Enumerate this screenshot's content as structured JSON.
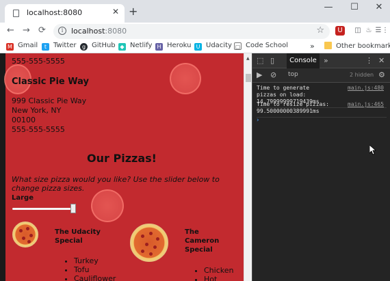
{
  "tab": {
    "title": "localhost:8080",
    "close": "✕",
    "new_tab": "+"
  },
  "window_controls": {
    "minimize": "—",
    "maximize": "☐",
    "close": "✕"
  },
  "toolbar": {
    "back": "←",
    "forward": "→",
    "reload": "⟳",
    "url_host": "localhost",
    "url_port": ":8080",
    "star": "☆",
    "ext1": "U",
    "ext2": "◫",
    "ext3": "♨",
    "ext4": "☰",
    "ext5": "⋮"
  },
  "bookmarks": [
    {
      "label": "Gmail",
      "icon": "M",
      "color": "#d93025"
    },
    {
      "label": "Twitter",
      "icon": "t",
      "color": "#1da1f2"
    },
    {
      "label": "GitHub",
      "icon": "g",
      "color": "#24292e"
    },
    {
      "label": "Netlify",
      "icon": "◆",
      "color": "#20c6b7"
    },
    {
      "label": "Heroku",
      "icon": "H",
      "color": "#6762a6"
    },
    {
      "label": "Udacity",
      "icon": "U",
      "color": "#02b3e4"
    },
    {
      "label": "Code School",
      "icon": "▢",
      "color": "#555"
    }
  ],
  "bookmarks_more": "»",
  "bookmarks_other": "Other bookmarks",
  "page": {
    "top_phone": "555-555-5555",
    "shop_name": "Classic Pie Way",
    "address": [
      "999 Classic Pie Way",
      "New York, NY",
      "00100",
      "555-555-5555"
    ],
    "heading": "Our Pizzas!",
    "instruction": "What size pizza would you like? Use the slider below to change pizza sizes.",
    "size_label": "Large",
    "pizza1_name": "The Udacity Special",
    "pizza1_ingredients": [
      "Turkey",
      "Tofu",
      "Cauliflower"
    ],
    "pizza2_name": "The Cameron Special",
    "pizza2_ingredients": [
      "Chicken",
      "Hot"
    ]
  },
  "devtools": {
    "tab": "Console",
    "more": "»",
    "context": "top",
    "hidden": "2 hidden",
    "messages": [
      {
        "text": "Time to generate pizzas on load: 14.79999999719439ms",
        "source": "main.js:480"
      },
      {
        "text": "Time to resize pizzas: 99.50000000389991ms",
        "source": "main.js:465"
      }
    ],
    "prompt": "›"
  },
  "colors": {
    "page_bg": "#c22a2f",
    "devtools_bg": "#242424",
    "accent": "#1a73e8"
  }
}
